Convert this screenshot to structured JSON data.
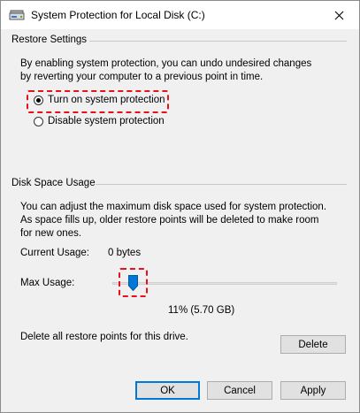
{
  "window": {
    "title": "System Protection for Local Disk (C:)"
  },
  "restore_settings": {
    "header": "Restore Settings",
    "description": "By enabling system protection, you can undo undesired changes by reverting your computer to a previous point in time.",
    "options": [
      {
        "label": "Turn on system protection",
        "selected": true
      },
      {
        "label": "Disable system protection",
        "selected": false
      }
    ]
  },
  "disk_space": {
    "header": "Disk Space Usage",
    "description": "You can adjust the maximum disk space used for system protection. As space fills up, older restore points will be deleted to make room for new ones.",
    "current_usage_label": "Current Usage:",
    "current_usage_value": "0 bytes",
    "max_usage_label": "Max Usage:",
    "max_usage_percent": 11,
    "max_usage_display": "11% (5.70 GB)",
    "delete_text": "Delete all restore points for this drive.",
    "delete_button": "Delete"
  },
  "buttons": {
    "ok": "OK",
    "cancel": "Cancel",
    "apply": "Apply"
  },
  "colors": {
    "accent": "#0078d7",
    "highlight": "#e8101a"
  },
  "icons": {
    "title": "drive-icon",
    "close": "close-icon"
  }
}
